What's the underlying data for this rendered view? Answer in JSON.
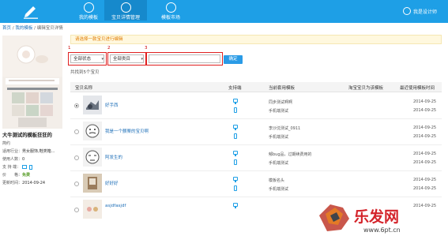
{
  "topbar": {
    "nav": [
      {
        "label": "我的模板"
      },
      {
        "label": "宝贝详情管理"
      },
      {
        "label": "模板市场"
      }
    ],
    "user": "我是设计师"
  },
  "breadcrumb": {
    "home": "首页",
    "sep": "/",
    "my_templates": "我的模板",
    "current": "编辑宝贝详情"
  },
  "sidebar": {
    "title": "大牛测试的模板狂狂的",
    "fields": [
      {
        "label": "简约",
        "value": ""
      },
      {
        "label": "适用行业：",
        "value": "男女服饰,鞋类箱..."
      },
      {
        "label": "使用人数：",
        "value": "0"
      },
      {
        "label": "支 持 端：",
        "value": ""
      },
      {
        "label": "价　　格：",
        "value": "免费"
      },
      {
        "label": "更新时间：",
        "value": "2014-09-24"
      }
    ]
  },
  "notice": "请选择一款宝贝进行编辑",
  "filters": {
    "numbers": [
      "1",
      "2",
      "3"
    ],
    "status": "全部状态",
    "category": "全部类目",
    "search_value": "",
    "confirm": "确定"
  },
  "count_text": "共找到5个宝贝",
  "table": {
    "headers": [
      "宝贝名称",
      "支持端",
      "当前套用模板",
      "淘宝宝贝为该模板",
      "最近使用模板时间"
    ],
    "rows": [
      {
        "name": "好手西",
        "pc_template": "同步测试啊啊",
        "mobile_template": "手机端测试",
        "date1": "2014-09-25",
        "date2": "2014-09-25",
        "checked": true
      },
      {
        "name": "我是一个颤栗的宝贝啊",
        "pc_template": "李沙沈测试_0911",
        "mobile_template": "手机端测试",
        "date1": "2014-09-25",
        "date2": "2014-09-25",
        "checked": false
      },
      {
        "name": "阿发生的",
        "pc_template": "郁bug品，过期续费用的",
        "mobile_template": "手机端测试",
        "date1": "2014-09-25",
        "date2": "2014-09-25",
        "checked": false
      },
      {
        "name": "好好好",
        "pc_template": "模板名头",
        "mobile_template": "手机端测试",
        "date1": "2014-09-25",
        "date2": "2014-09-25",
        "checked": false
      },
      {
        "name": "asjdfasjdf",
        "pc_template": "",
        "mobile_template": "",
        "date1": "2014-09-25",
        "date2": "",
        "checked": false
      }
    ]
  },
  "watermark": {
    "brand": "乐发网",
    "url": "www.6pt.cn"
  },
  "colors": {
    "topbar": "#1e9fe6",
    "accent_red": "#e02020",
    "link": "#1e6fb8",
    "notice_text": "#e07b00",
    "free": "#5a9e2b"
  }
}
